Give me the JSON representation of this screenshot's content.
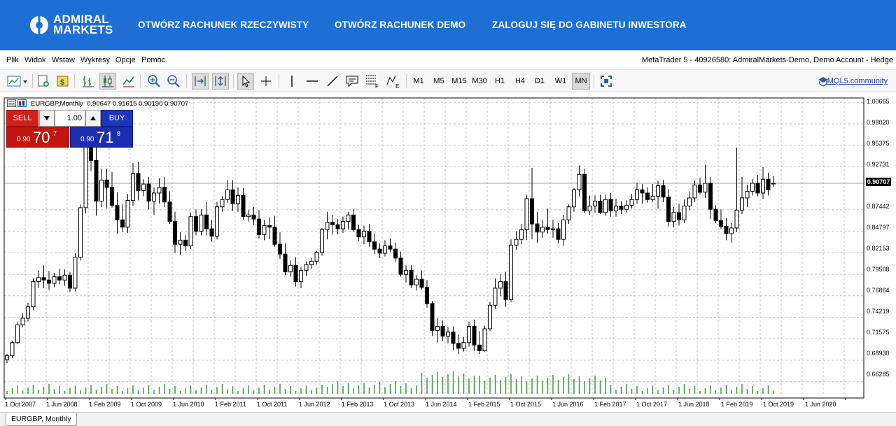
{
  "brand": {
    "logo_line1": "ADMIRAL",
    "logo_line2": "MARKETS",
    "nav": [
      {
        "label": "OTWÓRZ RACHUNEK RZECZYWISTY"
      },
      {
        "label": "OTWÓRZ RACHUNEK DEMO"
      },
      {
        "label": "ZALOGUJ SIĘ DO GABINETU INWESTORA"
      }
    ],
    "color": "#1d6fd6"
  },
  "menubar": {
    "items": [
      "Plik",
      "Widok",
      "Wstaw",
      "Wykresy",
      "Opcje",
      "Pomoc"
    ],
    "window_title": "MetaTrader 5 - 40926580: AdmiralMarkets-Demo, Demo Account - Hedge"
  },
  "toolbar": {
    "timeframes": [
      "M1",
      "M5",
      "M15",
      "M30",
      "H1",
      "H4",
      "D1",
      "W1",
      "MN"
    ],
    "active_timeframe": "MN",
    "community_link": "MQL5.community"
  },
  "chart": {
    "header": "EURGBP,Monthly  0.90647 0.91615 0.90190 0.90707",
    "current_price": "0.90707",
    "price_ticks": [
      "1.00665",
      "0.98020",
      "0.95375",
      "0.92731",
      "0.87442",
      "0.84797",
      "0.82153",
      "0.79508",
      "0.76864",
      "0.74219",
      "0.71575",
      "0.68930",
      "0.66285"
    ],
    "time_ticks": [
      "1 Oct 2007",
      "1 Jun 2008",
      "1 Feb 2009",
      "1 Oct 2009",
      "1 Jun 2010",
      "1 Feb 2011",
      "1 Oct 2011",
      "1 Jun 2012",
      "1 Feb 2013",
      "1 Oct 2013",
      "1 Jun 2014",
      "1 Feb 2015",
      "1 Oct 2015",
      "1 Jun 2016",
      "1 Feb 2017",
      "1 Oct 2017",
      "1 Jun 2018",
      "1 Feb 2019",
      "1 Oct 2019",
      "1 Jun 2020"
    ]
  },
  "trading": {
    "sell_label": "SELL",
    "buy_label": "BUY",
    "volume": "1.00",
    "bid_prefix": "0.90",
    "bid_big": "70",
    "bid_sup": "7",
    "ask_prefix": "0.90",
    "ask_big": "71",
    "ask_sup": "8",
    "sell_color": "#d0201a",
    "buy_color": "#1d35b9"
  },
  "tabs": [
    {
      "label": "EURGBP, Monthly"
    }
  ],
  "chart_data": {
    "type": "candlestick",
    "title": "EURGBP,Monthly",
    "ylim": [
      0.648,
      1.012
    ],
    "x_start": "2007-09",
    "x_end": "2020-08",
    "candles": [
      [
        0.69,
        0.697,
        0.686,
        0.695
      ],
      [
        0.695,
        0.713,
        0.692,
        0.711
      ],
      [
        0.711,
        0.737,
        0.709,
        0.733
      ],
      [
        0.733,
        0.747,
        0.73,
        0.741
      ],
      [
        0.741,
        0.76,
        0.737,
        0.755
      ],
      [
        0.755,
        0.79,
        0.751,
        0.786
      ],
      [
        0.786,
        0.8,
        0.778,
        0.791
      ],
      [
        0.791,
        0.806,
        0.778,
        0.788
      ],
      [
        0.788,
        0.799,
        0.776,
        0.784
      ],
      [
        0.784,
        0.797,
        0.779,
        0.792
      ],
      [
        0.792,
        0.802,
        0.783,
        0.788
      ],
      [
        0.788,
        0.801,
        0.781,
        0.794
      ],
      [
        0.794,
        0.798,
        0.773,
        0.778
      ],
      [
        0.778,
        0.821,
        0.774,
        0.816
      ],
      [
        0.816,
        0.881,
        0.812,
        0.877
      ],
      [
        0.877,
        0.98,
        0.87,
        0.954
      ],
      [
        0.954,
        0.992,
        0.922,
        0.935
      ],
      [
        0.935,
        0.954,
        0.867,
        0.885
      ],
      [
        0.885,
        0.925,
        0.878,
        0.911
      ],
      [
        0.911,
        0.925,
        0.876,
        0.902
      ],
      [
        0.902,
        0.921,
        0.877,
        0.88
      ],
      [
        0.88,
        0.896,
        0.845,
        0.862
      ],
      [
        0.862,
        0.881,
        0.847,
        0.853
      ],
      [
        0.853,
        0.894,
        0.846,
        0.886
      ],
      [
        0.886,
        0.932,
        0.879,
        0.919
      ],
      [
        0.919,
        0.933,
        0.886,
        0.898
      ],
      [
        0.898,
        0.912,
        0.891,
        0.906
      ],
      [
        0.906,
        0.915,
        0.875,
        0.885
      ],
      [
        0.885,
        0.902,
        0.868,
        0.895
      ],
      [
        0.895,
        0.913,
        0.882,
        0.902
      ],
      [
        0.902,
        0.915,
        0.878,
        0.884
      ],
      [
        0.884,
        0.897,
        0.857,
        0.86
      ],
      [
        0.86,
        0.872,
        0.821,
        0.832
      ],
      [
        0.832,
        0.847,
        0.819,
        0.837
      ],
      [
        0.837,
        0.843,
        0.824,
        0.83
      ],
      [
        0.83,
        0.871,
        0.826,
        0.866
      ],
      [
        0.866,
        0.875,
        0.843,
        0.848
      ],
      [
        0.848,
        0.875,
        0.843,
        0.868
      ],
      [
        0.868,
        0.884,
        0.843,
        0.851
      ],
      [
        0.851,
        0.862,
        0.835,
        0.842
      ],
      [
        0.842,
        0.884,
        0.838,
        0.878
      ],
      [
        0.878,
        0.891,
        0.872,
        0.887
      ],
      [
        0.887,
        0.911,
        0.883,
        0.899
      ],
      [
        0.899,
        0.911,
        0.873,
        0.882
      ],
      [
        0.882,
        0.902,
        0.872,
        0.892
      ],
      [
        0.892,
        0.901,
        0.862,
        0.866
      ],
      [
        0.866,
        0.874,
        0.86,
        0.868
      ],
      [
        0.868,
        0.878,
        0.856,
        0.863
      ],
      [
        0.863,
        0.874,
        0.839,
        0.844
      ],
      [
        0.844,
        0.862,
        0.837,
        0.855
      ],
      [
        0.855,
        0.865,
        0.838,
        0.853
      ],
      [
        0.853,
        0.867,
        0.829,
        0.832
      ],
      [
        0.832,
        0.847,
        0.814,
        0.82
      ],
      [
        0.82,
        0.833,
        0.794,
        0.798
      ],
      [
        0.798,
        0.812,
        0.792,
        0.806
      ],
      [
        0.806,
        0.816,
        0.78,
        0.786
      ],
      [
        0.786,
        0.804,
        0.778,
        0.8
      ],
      [
        0.8,
        0.811,
        0.793,
        0.807
      ],
      [
        0.807,
        0.815,
        0.802,
        0.811
      ],
      [
        0.811,
        0.824,
        0.807,
        0.822
      ],
      [
        0.822,
        0.852,
        0.818,
        0.85
      ],
      [
        0.85,
        0.872,
        0.838,
        0.859
      ],
      [
        0.859,
        0.868,
        0.844,
        0.856
      ],
      [
        0.856,
        0.863,
        0.844,
        0.851
      ],
      [
        0.851,
        0.866,
        0.846,
        0.86
      ],
      [
        0.86,
        0.872,
        0.85,
        0.868
      ],
      [
        0.868,
        0.875,
        0.847,
        0.85
      ],
      [
        0.85,
        0.856,
        0.836,
        0.841
      ],
      [
        0.841,
        0.855,
        0.832,
        0.848
      ],
      [
        0.848,
        0.857,
        0.829,
        0.835
      ],
      [
        0.835,
        0.845,
        0.82,
        0.826
      ],
      [
        0.826,
        0.833,
        0.815,
        0.821
      ],
      [
        0.821,
        0.837,
        0.817,
        0.83
      ],
      [
        0.83,
        0.839,
        0.822,
        0.826
      ],
      [
        0.826,
        0.834,
        0.81,
        0.815
      ],
      [
        0.815,
        0.823,
        0.792,
        0.795
      ],
      [
        0.795,
        0.806,
        0.785,
        0.8
      ],
      [
        0.8,
        0.806,
        0.778,
        0.782
      ],
      [
        0.782,
        0.794,
        0.775,
        0.789
      ],
      [
        0.789,
        0.8,
        0.776,
        0.779
      ],
      [
        0.779,
        0.788,
        0.754,
        0.759
      ],
      [
        0.759,
        0.762,
        0.719,
        0.726
      ],
      [
        0.726,
        0.741,
        0.711,
        0.731
      ],
      [
        0.731,
        0.738,
        0.713,
        0.719
      ],
      [
        0.719,
        0.73,
        0.71,
        0.724
      ],
      [
        0.724,
        0.731,
        0.702,
        0.71
      ],
      [
        0.71,
        0.721,
        0.697,
        0.704
      ],
      [
        0.704,
        0.718,
        0.7,
        0.711
      ],
      [
        0.711,
        0.737,
        0.706,
        0.731
      ],
      [
        0.731,
        0.739,
        0.701,
        0.708
      ],
      [
        0.708,
        0.725,
        0.697,
        0.701
      ],
      [
        0.701,
        0.732,
        0.7,
        0.728
      ],
      [
        0.728,
        0.761,
        0.725,
        0.757
      ],
      [
        0.757,
        0.79,
        0.752,
        0.778
      ],
      [
        0.778,
        0.795,
        0.768,
        0.786
      ],
      [
        0.786,
        0.798,
        0.755,
        0.764
      ],
      [
        0.764,
        0.838,
        0.761,
        0.831
      ],
      [
        0.831,
        0.848,
        0.825,
        0.838
      ],
      [
        0.838,
        0.857,
        0.832,
        0.85
      ],
      [
        0.85,
        0.893,
        0.837,
        0.888
      ],
      [
        0.888,
        0.926,
        0.838,
        0.857
      ],
      [
        0.857,
        0.872,
        0.834,
        0.847
      ],
      [
        0.847,
        0.862,
        0.84,
        0.853
      ],
      [
        0.853,
        0.876,
        0.845,
        0.85
      ],
      [
        0.85,
        0.862,
        0.84,
        0.851
      ],
      [
        0.851,
        0.858,
        0.833,
        0.838
      ],
      [
        0.838,
        0.868,
        0.83,
        0.862
      ],
      [
        0.862,
        0.881,
        0.857,
        0.878
      ],
      [
        0.878,
        0.901,
        0.872,
        0.899
      ],
      [
        0.899,
        0.929,
        0.891,
        0.918
      ],
      [
        0.918,
        0.925,
        0.87,
        0.873
      ],
      [
        0.873,
        0.892,
        0.868,
        0.879
      ],
      [
        0.879,
        0.892,
        0.871,
        0.885
      ],
      [
        0.885,
        0.893,
        0.869,
        0.871
      ],
      [
        0.871,
        0.893,
        0.867,
        0.887
      ],
      [
        0.887,
        0.895,
        0.866,
        0.873
      ],
      [
        0.873,
        0.888,
        0.866,
        0.879
      ],
      [
        0.879,
        0.885,
        0.869,
        0.875
      ],
      [
        0.875,
        0.886,
        0.871,
        0.88
      ],
      [
        0.88,
        0.894,
        0.876,
        0.887
      ],
      [
        0.887,
        0.908,
        0.882,
        0.899
      ],
      [
        0.899,
        0.906,
        0.882,
        0.895
      ],
      [
        0.895,
        0.902,
        0.883,
        0.887
      ],
      [
        0.887,
        0.906,
        0.884,
        0.891
      ],
      [
        0.891,
        0.91,
        0.876,
        0.904
      ],
      [
        0.904,
        0.911,
        0.884,
        0.89
      ],
      [
        0.89,
        0.9,
        0.854,
        0.86
      ],
      [
        0.86,
        0.878,
        0.853,
        0.871
      ],
      [
        0.871,
        0.882,
        0.855,
        0.862
      ],
      [
        0.862,
        0.887,
        0.858,
        0.879
      ],
      [
        0.879,
        0.897,
        0.874,
        0.889
      ],
      [
        0.889,
        0.91,
        0.884,
        0.905
      ],
      [
        0.905,
        0.914,
        0.893,
        0.896
      ],
      [
        0.896,
        0.93,
        0.889,
        0.907
      ],
      [
        0.907,
        0.915,
        0.863,
        0.875
      ],
      [
        0.875,
        0.88,
        0.858,
        0.861
      ],
      [
        0.861,
        0.875,
        0.851,
        0.854
      ],
      [
        0.854,
        0.864,
        0.837,
        0.845
      ],
      [
        0.845,
        0.858,
        0.834,
        0.852
      ],
      [
        0.852,
        0.951,
        0.847,
        0.874
      ],
      [
        0.874,
        0.915,
        0.869,
        0.889
      ],
      [
        0.889,
        0.905,
        0.878,
        0.897
      ],
      [
        0.897,
        0.912,
        0.892,
        0.907
      ],
      [
        0.907,
        0.917,
        0.891,
        0.895
      ],
      [
        0.895,
        0.927,
        0.888,
        0.912
      ],
      [
        0.912,
        0.92,
        0.892,
        0.899
      ],
      [
        0.907,
        0.916,
        0.902,
        0.907
      ]
    ]
  }
}
